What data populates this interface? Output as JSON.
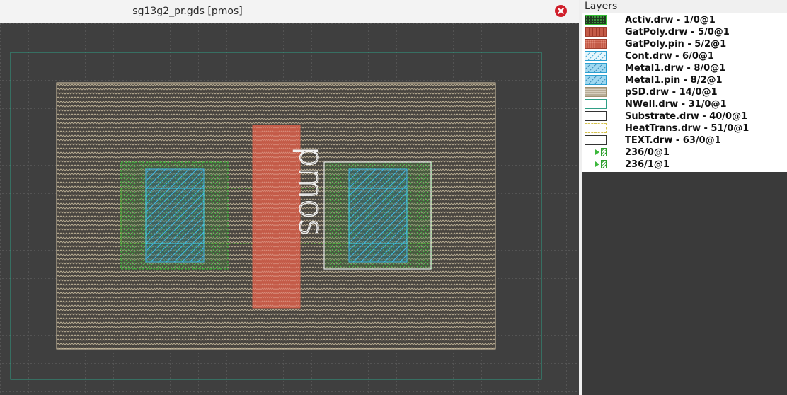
{
  "window": {
    "title": "sg13g2_pr.gds [pmos]"
  },
  "icons": {
    "close": "close-icon",
    "expand": "expand-triangle-icon"
  },
  "colors": {
    "canvas_bg": "#3f3f3f",
    "grid": "#6a6a6a",
    "nwell": "#2f9f86",
    "psd": "#d8c8a8",
    "activ": "#35c235",
    "gatpoly": "#c65e4a",
    "metal1": "#3fb6e6",
    "text_box": "#e8e8e8"
  },
  "layout": {
    "cell_text": "pmos"
  },
  "layers_panel": {
    "title": "Layers",
    "layers": [
      {
        "label": "Activ.drw - 1/0@1",
        "swatch": "activ"
      },
      {
        "label": "GatPoly.drw - 5/0@1",
        "swatch": "gatpoly-drw"
      },
      {
        "label": "GatPoly.pin - 5/2@1",
        "swatch": "gatpoly-pin"
      },
      {
        "label": "Cont.drw - 6/0@1",
        "swatch": "cont"
      },
      {
        "label": "Metal1.drw - 8/0@1",
        "swatch": "metal1"
      },
      {
        "label": "Metal1.pin - 8/2@1",
        "swatch": "metal1"
      },
      {
        "label": "pSD.drw - 14/0@1",
        "swatch": "psd"
      },
      {
        "label": "NWell.drw - 31/0@1",
        "swatch": "nwell"
      },
      {
        "label": "Substrate.drw - 40/0@1",
        "swatch": "substrate"
      },
      {
        "label": "HeatTrans.drw - 51/0@1",
        "swatch": "heattrans"
      },
      {
        "label": "TEXT.drw - 63/0@1",
        "swatch": "text"
      },
      {
        "label": "236/0@1",
        "swatch": "group"
      },
      {
        "label": "236/1@1",
        "swatch": "group"
      }
    ]
  }
}
